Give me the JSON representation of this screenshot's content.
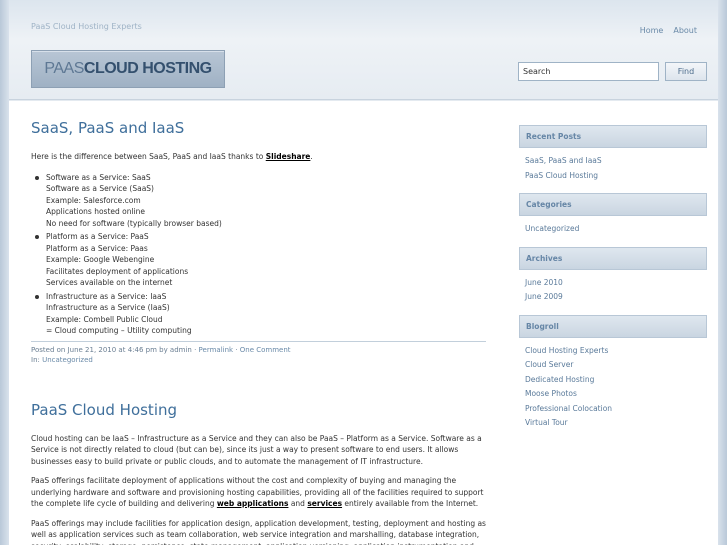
{
  "header": {
    "tagline": "PaaS Cloud Hosting Experts",
    "nav": [
      "Home",
      "About"
    ],
    "logo_prefix": "PAAS",
    "logo_main": "CLOUD HOSTING",
    "search_value": "Search",
    "search_button": "Find"
  },
  "post1": {
    "title": "SaaS, PaaS and IaaS",
    "intro_pre": "Here is the difference between SaaS, PaaS and IaaS thanks to ",
    "intro_link": "Slideshare",
    "intro_post": ".",
    "items": [
      {
        "lines": [
          "Software as a Service: SaaS",
          "Software as a Service (SaaS)",
          "Example: Salesforce.com",
          "Applications hosted online",
          "No need for software (typically browser based)"
        ]
      },
      {
        "lines": [
          "Platform as a Service: PaaS",
          "Platform as a Service: Paas",
          "Example: Google Webengine",
          "Facilitates deployment of applications",
          "Services available on the internet"
        ]
      },
      {
        "lines": [
          "Infrastructure as a Service: IaaS",
          "Infrastructure as a Service (IaaS)",
          "Example: Combell Public Cloud",
          "= Cloud computing – Utility computing"
        ]
      }
    ],
    "meta_posted": "Posted on June 21, 2010 at 4:46 pm by admin · ",
    "meta_permalink": "Permalink",
    "meta_sep": " · ",
    "meta_comment": "One Comment",
    "meta_in": "In: ",
    "meta_category": "Uncategorized"
  },
  "post2": {
    "title": "PaaS Cloud Hosting",
    "p1": "Cloud hosting can be IaaS – Infrastructure as a Service and they can also be PaaS – Platform as a Service.  Software as a Service is not directly related to cloud (but can be), since its just a way to present software to end users. It allows businesses easy to build private or public clouds, and to automate the management of IT infrastructure.",
    "p2_pre": "PaaS offerings facilitate deployment of applications without the cost and complexity of buying and managing the underlying hardware and software and provisioning hosting capabilities, providing all of the facilities required to support the complete life cycle of building and delivering ",
    "p2_link1": "web applications",
    "p2_mid": " and ",
    "p2_link2": "services",
    "p2_post": " entirely available from the Internet.",
    "p3": "PaaS offerings may include facilities for application design, application development, testing, deployment and hosting as well as application services such as team collaboration, web service integration and marshalling, database integration, security, scalability, storage, persistence, state management, application versioning, application instrumentation and developer"
  },
  "sidebar": {
    "recent_posts": {
      "title": "Recent Posts",
      "items": [
        "SaaS, PaaS and IaaS",
        "PaaS Cloud Hosting"
      ]
    },
    "categories": {
      "title": "Categories",
      "items": [
        "Uncategorized"
      ]
    },
    "archives": {
      "title": "Archives",
      "items": [
        "June 2010",
        "June 2009"
      ]
    },
    "blogroll": {
      "title": "Blogroll",
      "items": [
        "Cloud Hosting Experts",
        "Cloud Server",
        "Dedicated Hosting",
        "Moose Photos",
        "Professional Colocation",
        "Virtual Tour"
      ]
    }
  }
}
